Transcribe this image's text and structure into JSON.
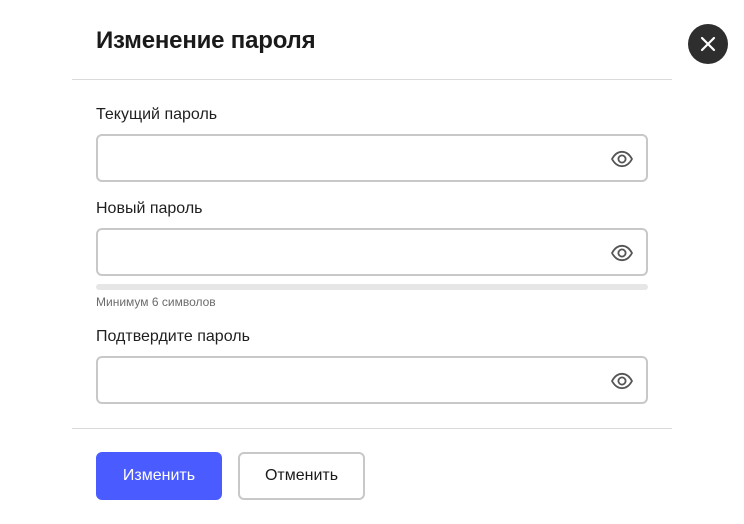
{
  "dialog": {
    "title": "Изменение пароля",
    "close_icon": "close-icon"
  },
  "fields": {
    "current": {
      "label": "Текущий пароль",
      "value": "",
      "placeholder": "",
      "icon": "eye-icon"
    },
    "new": {
      "label": "Новый пароль",
      "value": "",
      "placeholder": "",
      "icon": "eye-icon",
      "hint": "Минимум 6 символов",
      "strength": 0
    },
    "confirm": {
      "label": "Подтвердите пароль",
      "value": "",
      "placeholder": "",
      "icon": "eye-icon"
    }
  },
  "actions": {
    "submit_label": "Изменить",
    "cancel_label": "Отменить"
  },
  "colors": {
    "accent": "#4a5bff",
    "close_button_bg": "#2e2e2e",
    "border": "#c8c8c8",
    "strength_track": "#e6e6e6"
  }
}
